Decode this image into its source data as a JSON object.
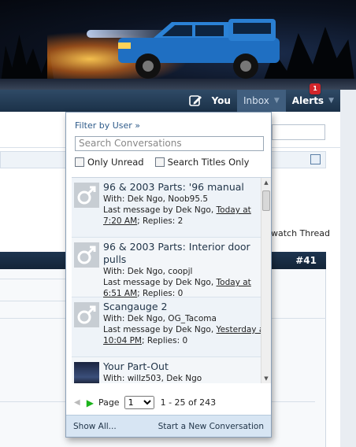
{
  "nav": {
    "you_label": "You",
    "inbox_label": "Inbox",
    "alerts_label": "Alerts",
    "alerts_count": "1",
    "caret": "▼"
  },
  "background": {
    "watch_thread": "watch Thread",
    "post_number": "#41"
  },
  "inbox": {
    "filter_label": "Filter by User »",
    "search_placeholder": "Search Conversations",
    "only_unread_label": "Only Unread",
    "search_titles_label": "Search Titles Only",
    "conversations": [
      {
        "title": "96 & 2003 Parts: '96 manual",
        "with": "With: Dek Ngo, Noob95.5",
        "last_prefix": "Last message by Dek Ngo, ",
        "last_time": "Today at 7:20 AM",
        "replies": "; Replies: 2",
        "avatar": "male-symbol-avatar"
      },
      {
        "title": "96 & 2003 Parts:  Interior door pulls",
        "with": "With: Dek Ngo, coopjl",
        "last_prefix": "Last message by Dek Ngo, ",
        "last_time": "Today at 6:51 AM",
        "replies": "; Replies: 0",
        "avatar": "male-symbol-avatar"
      },
      {
        "title": "Scangauge 2",
        "with": "With: Dek Ngo, OG_Tacoma",
        "last_prefix": "Last message by Dek Ngo, ",
        "last_time": "Yesterday at 10:04 PM",
        "replies": "; Replies: 0",
        "avatar": "male-symbol-avatar"
      },
      {
        "title": "Your Part-Out",
        "with": "With: willz503, Dek Ngo",
        "last_prefix": "",
        "last_time": "",
        "replies": "",
        "avatar": "night-sky-photo"
      }
    ],
    "pager": {
      "page_label": "Page",
      "current_page": "1",
      "range": "1 - 25 of 243"
    },
    "footer": {
      "show_all": "Show All...",
      "new_conversation": "Start a New Conversation"
    }
  },
  "colors": {
    "nav_bg": "#1b3148",
    "active_tab": "#405e7e",
    "alert_badge": "#d1252a",
    "link": "#2e5b8a",
    "footer_bg": "#d7e5f3"
  }
}
